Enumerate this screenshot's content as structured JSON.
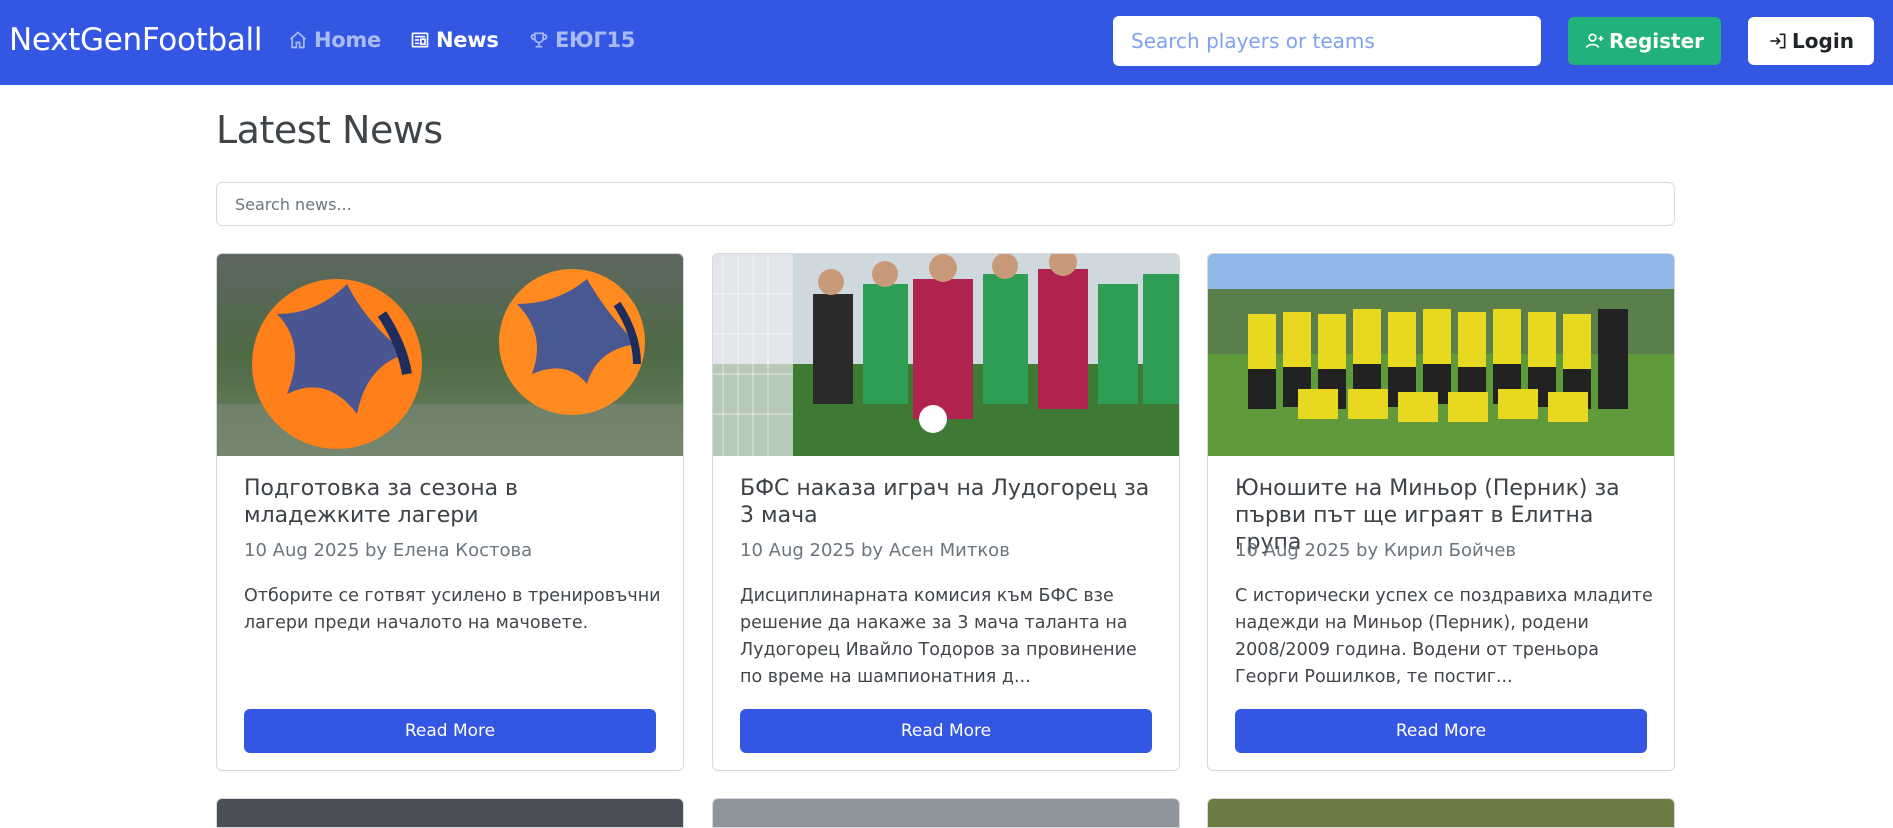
{
  "navbar": {
    "brand": "NextGenFootball",
    "links": [
      {
        "label": "Home",
        "icon": "home-icon"
      },
      {
        "label": "News",
        "icon": "newspaper-icon"
      },
      {
        "label": "ЕЮГ15",
        "icon": "trophy-icon"
      }
    ],
    "search_placeholder": "Search players or teams",
    "register_label": "Register",
    "login_label": "Login"
  },
  "colors": {
    "primary": "#3457e3",
    "success": "#20b27a"
  },
  "page": {
    "title": "Latest News",
    "search_placeholder": "Search news..."
  },
  "articles": [
    {
      "title": "Подготовка за сезона в младежките лагери",
      "meta": "10 Aug 2025 by Елена Костова",
      "excerpt": "Отборите се готвят усилено в тренировъчни лагери преди началото на мачовете.",
      "button": "Read More"
    },
    {
      "title": "БФС наказа играч на Лудогорец за 3 мача",
      "meta": "10 Aug 2025 by Асен Митков",
      "excerpt": "Дисциплинарната комисия към БФС взе решение да накаже за 3 мача таланта на Лудогорец Ивайло Тодоров за провинение по време на шампионатния д...",
      "button": "Read More"
    },
    {
      "title": "Юношите на Миньор (Перник) за първи път ще играят в Елитна група",
      "meta": "10 Aug 2025 by Кирил Бойчев",
      "excerpt": "С исторически успех се поздравиха младите надежди на Миньор (Перник), родени 2008/2009 година. Водени от треньора Георги Рошилков, те постиг...",
      "button": "Read More"
    }
  ]
}
